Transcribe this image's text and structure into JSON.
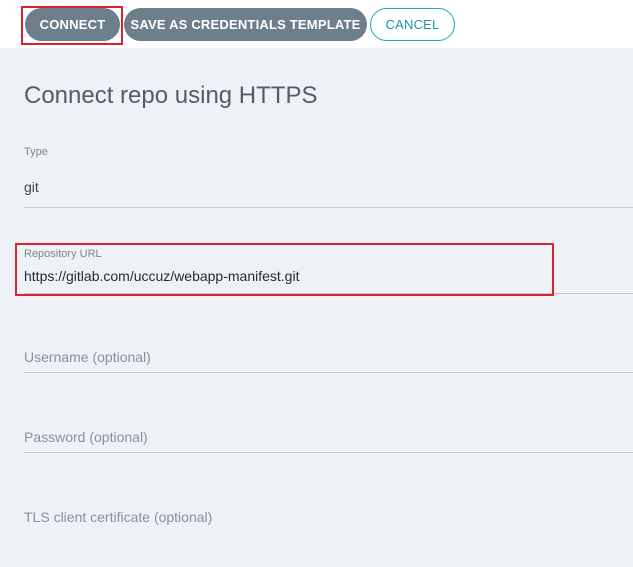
{
  "toolbar": {
    "connect_label": "CONNECT",
    "template_label": "SAVE AS CREDENTIALS TEMPLATE",
    "cancel_label": "CANCEL"
  },
  "form": {
    "title": "Connect repo using HTTPS",
    "type": {
      "label": "Type",
      "value": "git"
    },
    "repo_url": {
      "label": "Repository URL",
      "value": "https://gitlab.com/uccuz/webapp-manifest.git"
    },
    "username": {
      "placeholder": "Username (optional)"
    },
    "password": {
      "placeholder": "Password (optional)"
    },
    "tls_cert": {
      "placeholder": "TLS client certificate (optional)"
    }
  },
  "colors": {
    "primary_button": "#6d7f8b",
    "cancel_accent": "#1a95ab",
    "highlight": "#d9232e",
    "background": "#eef1f5"
  }
}
